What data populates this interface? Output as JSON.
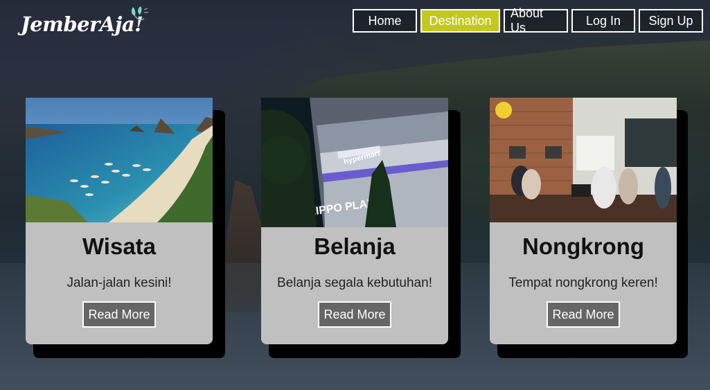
{
  "brand": {
    "logo_text": "JemberAja!"
  },
  "nav": {
    "items": [
      {
        "label": "Home"
      },
      {
        "label": "Destination"
      },
      {
        "label": "About Us"
      },
      {
        "label": "Log In"
      },
      {
        "label": "Sign Up"
      }
    ],
    "active": "Destination",
    "accent_color": "#c3c81e"
  },
  "cards": [
    {
      "title": "Wisata",
      "description": "Jalan-jalan kesini!",
      "button": "Read More",
      "image": "beach-photo"
    },
    {
      "title": "Belanja",
      "description": "Belanja segala kebutuhan!",
      "button": "Read More",
      "image": "mall-photo",
      "image_text": [
        "hypermart",
        "LIPPO PLAZA"
      ]
    },
    {
      "title": "Nongkrong",
      "description": "Tempat nongkrong keren!",
      "button": "Read More",
      "image": "cafe-photo"
    }
  ]
}
